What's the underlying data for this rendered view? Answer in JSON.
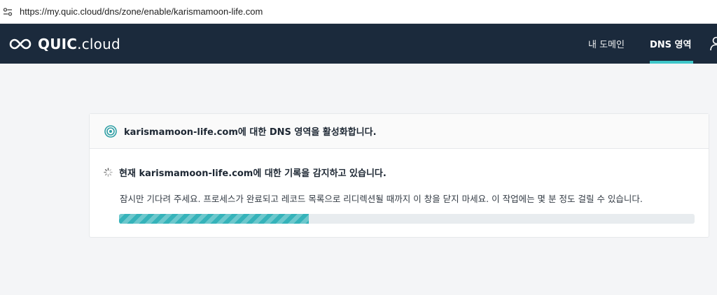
{
  "browser": {
    "url": "https://my.quic.cloud/dns/zone/enable/karismamoon-life.com"
  },
  "header": {
    "brand": {
      "part1": "QUIC",
      "part2": ".cloud"
    },
    "nav": [
      {
        "label": "내 도메인"
      },
      {
        "label": "DNS 영역",
        "active": true
      }
    ],
    "accent_color": "#3ec6c9",
    "background_color": "#1b2a3c"
  },
  "card": {
    "title": "karismamoon-life.com에 대한 DNS 영역을 활성화합니다.",
    "status": "현재 karismamoon-life.com에 대한 기록을 감지하고 있습니다.",
    "description": "잠시만 기다려 주세요. 프로세스가 완료되고 레코드 목록으로 리디렉션될 때까지 이 창을 닫지 마세요. 이 작업에는 몇 분 정도 걸릴 수 있습니다.",
    "progress_percent": 33,
    "progress_color": "#35b3ba"
  },
  "icons": {
    "address_bar": "site-info-icon",
    "brand": "quic-cloud-logo-icon",
    "user": "user-icon",
    "card_header": "target-icon",
    "status": "spinner-icon"
  }
}
